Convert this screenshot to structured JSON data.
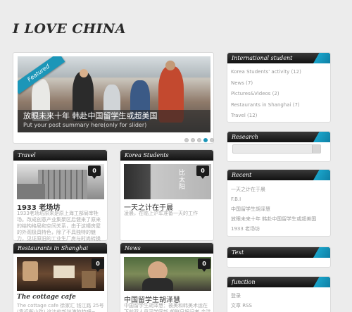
{
  "site": {
    "title": "I LOVE CHINA"
  },
  "slider": {
    "ribbon": "Featured",
    "caption_title": "放眼未来十年 韩赴中国留学生或超美国",
    "caption_text": "Put your post summary here(only for slider)",
    "active_dot": 4
  },
  "posts": [
    {
      "category": "Travel",
      "comments": "0",
      "title": "1933 老场坊",
      "excerpt": "1933老场坊原来是原上海工部局宰牲场。改成创意产业集聚区后健来了原来的结构格局和空间关系，由于这幢房屋的外观极具特色，除了不具独特的魅力，见证原旧的工业生厂房与时尚转换中的建筑正在化为空气与商业的新生重中心。功能建于民国的大楼与不规则的建筑。"
    },
    {
      "category": "Korea Students",
      "comments": "0",
      "title": "一天之计在于晨",
      "excerpt": "凌晨，在临上沪车准备一天的工作",
      "image_text": "比 太 阳"
    },
    {
      "category": "Restaurants in Shanghai",
      "comments": "0",
      "title": "The cottage cafe",
      "excerpt": "The cottage cafe 徐家汇 钱江路 25号 (靠近衡山路) 这边的新装潢独特吧~"
    },
    {
      "category": "News",
      "comments": "0",
      "title": "中国留学生胡泽慧",
      "excerpt": "中国留学生胡泽慧：被美和韩美术运在下前双人员河学网新 朝鲜日报记者 金洪周"
    }
  ],
  "sidebar": {
    "international": {
      "title": "International student",
      "items": [
        "Korea Students' activity (12)",
        "News (7)",
        "Pictures&Videos (2)",
        "Restaurants in Shanghai (7)",
        "Travel (12)"
      ]
    },
    "search": {
      "title": "Research",
      "placeholder": ""
    },
    "recent": {
      "title": "Recent",
      "items": [
        "一天之计在于晨",
        "F.B.I",
        "中国留学生胡泽慧",
        "放眼未来十年 韩赴中国留学生或超美国",
        "1933 老场坊"
      ]
    },
    "text": {
      "title": "Text"
    },
    "function": {
      "title": "function",
      "items": [
        "登录",
        "文章 RSS"
      ]
    }
  },
  "colors": {
    "accent": "#1c96b8",
    "header": "#1a1a1a",
    "background": "#ececec"
  }
}
